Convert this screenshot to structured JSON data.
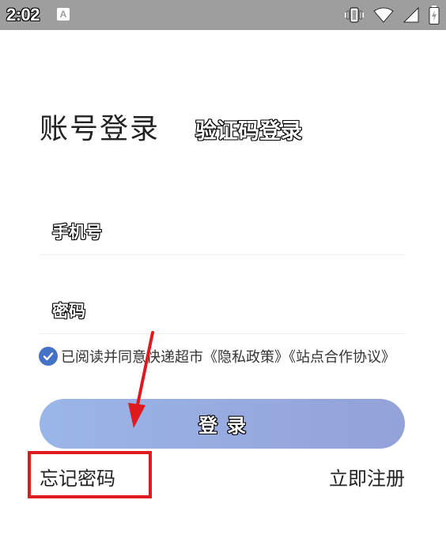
{
  "status_bar": {
    "time": "2:02",
    "notification_letter": "A",
    "icons": [
      "vibrate-icon",
      "wifi-icon",
      "signal-icon",
      "battery-charging-icon"
    ]
  },
  "tabs": {
    "password_login": "账号登录",
    "code_login": "验证码登录"
  },
  "fields": {
    "phone_label": "手机号",
    "password_label": "密码"
  },
  "agreement": {
    "checked": true,
    "text": "已阅读并同意快递超市《隐私政策》《站点合作协议》"
  },
  "login_button": {
    "label": "登录"
  },
  "links": {
    "forgot_password": "忘记密码",
    "register": "立即注册"
  },
  "annotation": {
    "box_color": "#e0191f",
    "arrow_color": "#e0191f"
  },
  "colors": {
    "button_gradient_start": "#9ab6e8",
    "button_gradient_end": "#93a2d9",
    "checkbox": "#4472c4",
    "status_bar": "#9e9e9e"
  }
}
